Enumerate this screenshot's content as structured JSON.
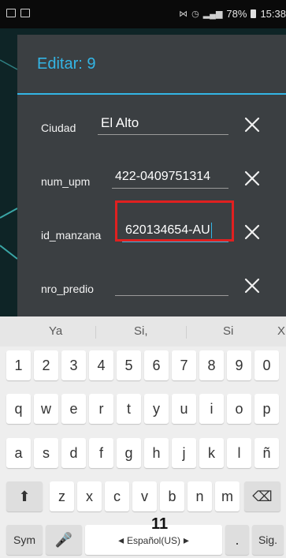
{
  "status_bar": {
    "battery": "78%",
    "time": "15:38"
  },
  "dialog": {
    "title": "Editar: 9",
    "fields": [
      {
        "label": "Ciudad",
        "value": "El Alto"
      },
      {
        "label": "num_upm",
        "value": "422-0409751314"
      },
      {
        "label": "id_manzana",
        "value": "620134654-AU"
      },
      {
        "label": "nro_predio",
        "value": ""
      }
    ]
  },
  "keyboard": {
    "suggestions": [
      "Ya",
      "Si,",
      "Si",
      "X"
    ],
    "rows": [
      [
        "1",
        "2",
        "3",
        "4",
        "5",
        "6",
        "7",
        "8",
        "9",
        "0"
      ],
      [
        "q",
        "w",
        "e",
        "r",
        "t",
        "y",
        "u",
        "i",
        "o",
        "p"
      ],
      [
        "a",
        "s",
        "d",
        "f",
        "g",
        "h",
        "j",
        "k",
        "l",
        "ñ"
      ],
      [
        "z",
        "x",
        "c",
        "v",
        "b",
        "n",
        "m"
      ]
    ],
    "sym_label": "Sym",
    "space_label": "Español(US)",
    "period_label": ".",
    "next_label": "Sig."
  },
  "annotation": {
    "page_number": "11"
  },
  "colors": {
    "accent": "#33b5e5",
    "highlight": "#e02020",
    "dialog_bg": "#3b3f42"
  }
}
